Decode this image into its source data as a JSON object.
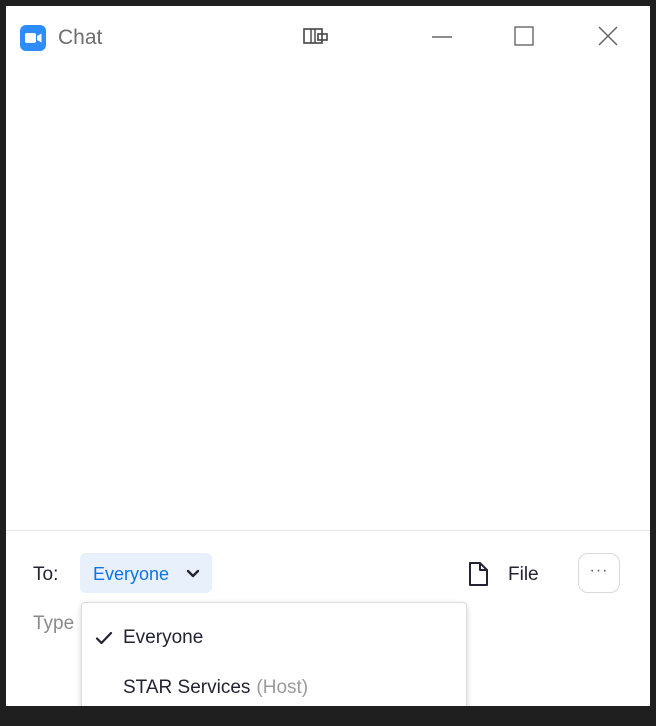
{
  "window": {
    "title": "Chat",
    "icons": {
      "app": "zoom-video-icon",
      "popout": "popout-icon",
      "minimize": "minimize-icon",
      "maximize": "maximize-icon",
      "close": "close-icon"
    }
  },
  "composer": {
    "to_label": "To:",
    "recipient": "Everyone",
    "file_label": "File",
    "more_label": "···",
    "placeholder": "Type"
  },
  "dropdown": {
    "items": [
      {
        "label": "Everyone",
        "sub": "",
        "selected": true
      },
      {
        "label": "STAR Services",
        "sub": "(Host)",
        "selected": false
      }
    ]
  },
  "colors": {
    "accent": "#0e72ed",
    "recipient_bg": "#e8f1fb",
    "text": "#232333",
    "muted": "#9a9a9a"
  }
}
